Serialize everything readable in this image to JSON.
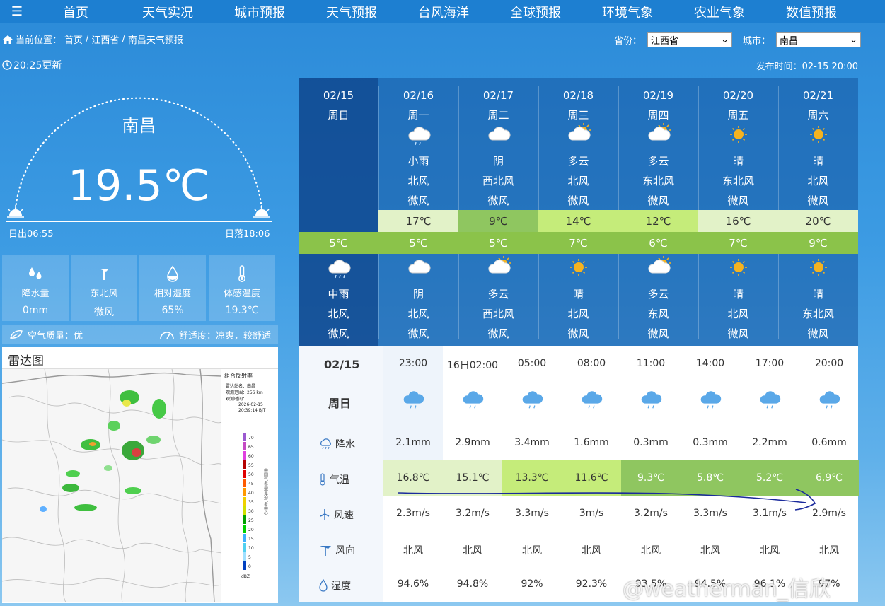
{
  "nav": {
    "items": [
      "首页",
      "天气实况",
      "城市预报",
      "天气预报",
      "台风海洋",
      "全球预报",
      "环境气象",
      "农业气象",
      "数值预报"
    ]
  },
  "breadcrumb": {
    "prefix": "当前位置：",
    "items": [
      "首页",
      "江西省",
      "南昌天气预报"
    ]
  },
  "selects": {
    "province_label": "省份：",
    "province_value": "江西省",
    "city_label": "城市：",
    "city_value": "南昌"
  },
  "update_time": "20:25更新",
  "publish_time": "发布时间：02-15 20:00",
  "current": {
    "city": "南昌",
    "temperature": "19.5℃",
    "sunrise": "日出06:55",
    "sunset": "日落18:06"
  },
  "tiles": [
    {
      "label": "降水量",
      "value": "0mm",
      "icon": "rain-drops-icon"
    },
    {
      "label": "东北风",
      "value": "微风",
      "icon": "wind-vane-icon"
    },
    {
      "label": "相对湿度",
      "value": "65%",
      "icon": "humidity-drop-icon"
    },
    {
      "label": "体感温度",
      "value": "19.3℃",
      "icon": "thermometer-icon"
    }
  ],
  "air": {
    "aq": "空气质量：优",
    "comfort": "舒适度：凉爽，较舒适"
  },
  "radar": {
    "title": "雷达图",
    "legend_title": "组合反射率",
    "station": "雷达站名：南昌",
    "range": "观测范围：256 km",
    "time_label": "观测时间：",
    "date": "2026-02-15",
    "time": "20:39:14 BJT",
    "scale": [
      "70",
      "65",
      "60",
      "55",
      "50",
      "45",
      "40",
      "35",
      "30",
      "25",
      "20",
      "15",
      "10",
      "5",
      "0"
    ],
    "unit": "dBZ",
    "vertical": "中国气象局雷达气象中心"
  },
  "week": [
    {
      "date": "02/15",
      "dow": "周日",
      "day_weather": "",
      "day_wind": "",
      "day_wind_level": "",
      "hi": "",
      "lo": "5℃",
      "night_weather": "中雨",
      "night_wind": "北风",
      "night_wind_level": "微风",
      "day_icon": "",
      "night_icon": "moderate-rain-icon"
    },
    {
      "date": "02/16",
      "dow": "周一",
      "day_weather": "小雨",
      "day_wind": "北风",
      "day_wind_level": "微风",
      "hi": "17℃",
      "lo": "5℃",
      "night_weather": "阴",
      "night_wind": "北风",
      "night_wind_level": "微风",
      "day_icon": "light-rain-icon",
      "night_icon": "overcast-icon"
    },
    {
      "date": "02/17",
      "dow": "周二",
      "day_weather": "阴",
      "day_wind": "西北风",
      "day_wind_level": "微风",
      "hi": "9℃",
      "lo": "5℃",
      "night_weather": "多云",
      "night_wind": "西北风",
      "night_wind_level": "微风",
      "day_icon": "overcast-icon",
      "night_icon": "partly-cloudy-icon"
    },
    {
      "date": "02/18",
      "dow": "周三",
      "day_weather": "多云",
      "day_wind": "北风",
      "day_wind_level": "微风",
      "hi": "14℃",
      "lo": "7℃",
      "night_weather": "晴",
      "night_wind": "北风",
      "night_wind_level": "微风",
      "day_icon": "partly-cloudy-icon",
      "night_icon": "sunny-icon"
    },
    {
      "date": "02/19",
      "dow": "周四",
      "day_weather": "多云",
      "day_wind": "东北风",
      "day_wind_level": "微风",
      "hi": "12℃",
      "lo": "6℃",
      "night_weather": "多云",
      "night_wind": "东风",
      "night_wind_level": "微风",
      "day_icon": "partly-cloudy-icon",
      "night_icon": "partly-cloudy-icon"
    },
    {
      "date": "02/20",
      "dow": "周五",
      "day_weather": "晴",
      "day_wind": "东北风",
      "day_wind_level": "微风",
      "hi": "16℃",
      "lo": "7℃",
      "night_weather": "晴",
      "night_wind": "北风",
      "night_wind_level": "微风",
      "day_icon": "sunny-icon",
      "night_icon": "sunny-icon"
    },
    {
      "date": "02/21",
      "dow": "周六",
      "day_weather": "晴",
      "day_wind": "北风",
      "day_wind_level": "微风",
      "hi": "20℃",
      "lo": "9℃",
      "night_weather": "晴",
      "night_wind": "东北风",
      "night_wind_level": "微风",
      "day_icon": "sunny-icon",
      "night_icon": "sunny-icon"
    }
  ],
  "hourly": {
    "date": "02/15",
    "dow": "周日",
    "labels": {
      "precip": "降水",
      "temp": "气温",
      "wind_speed": "风速",
      "wind_dir": "风向",
      "humidity": "湿度"
    },
    "times": [
      "23:00",
      "16日02:00",
      "05:00",
      "08:00",
      "11:00",
      "14:00",
      "17:00",
      "20:00"
    ],
    "precip": [
      "2.1mm",
      "2.9mm",
      "3.4mm",
      "1.6mm",
      "0.3mm",
      "0.3mm",
      "2.2mm",
      "0.6mm"
    ],
    "temp": [
      "16.8℃",
      "15.1℃",
      "13.3℃",
      "11.6℃",
      "9.3℃",
      "5.8℃",
      "5.2℃",
      "6.9℃"
    ],
    "wind_speed": [
      "2.3m/s",
      "3.2m/s",
      "3.3m/s",
      "3m/s",
      "3.2m/s",
      "3.3m/s",
      "3.1m/s",
      "2.9m/s"
    ],
    "wind_dir": [
      "北风",
      "北风",
      "北风",
      "北风",
      "北风",
      "北风",
      "北风",
      "北风"
    ],
    "humidity": [
      "94.6%",
      "94.8%",
      "92%",
      "92.3%",
      "93.5%",
      "94.5%",
      "96.1%",
      "97%"
    ]
  },
  "watermark": "@weatherman_信欣",
  "colors": {
    "nav_bg": "#1d7fd1",
    "hi_light": "#e2f2c8",
    "hi_mid": "#8fc660",
    "hi_bright": "#c5ec7a",
    "lo_bar": "#8bc34a",
    "annotation": "#1a2a9c"
  }
}
